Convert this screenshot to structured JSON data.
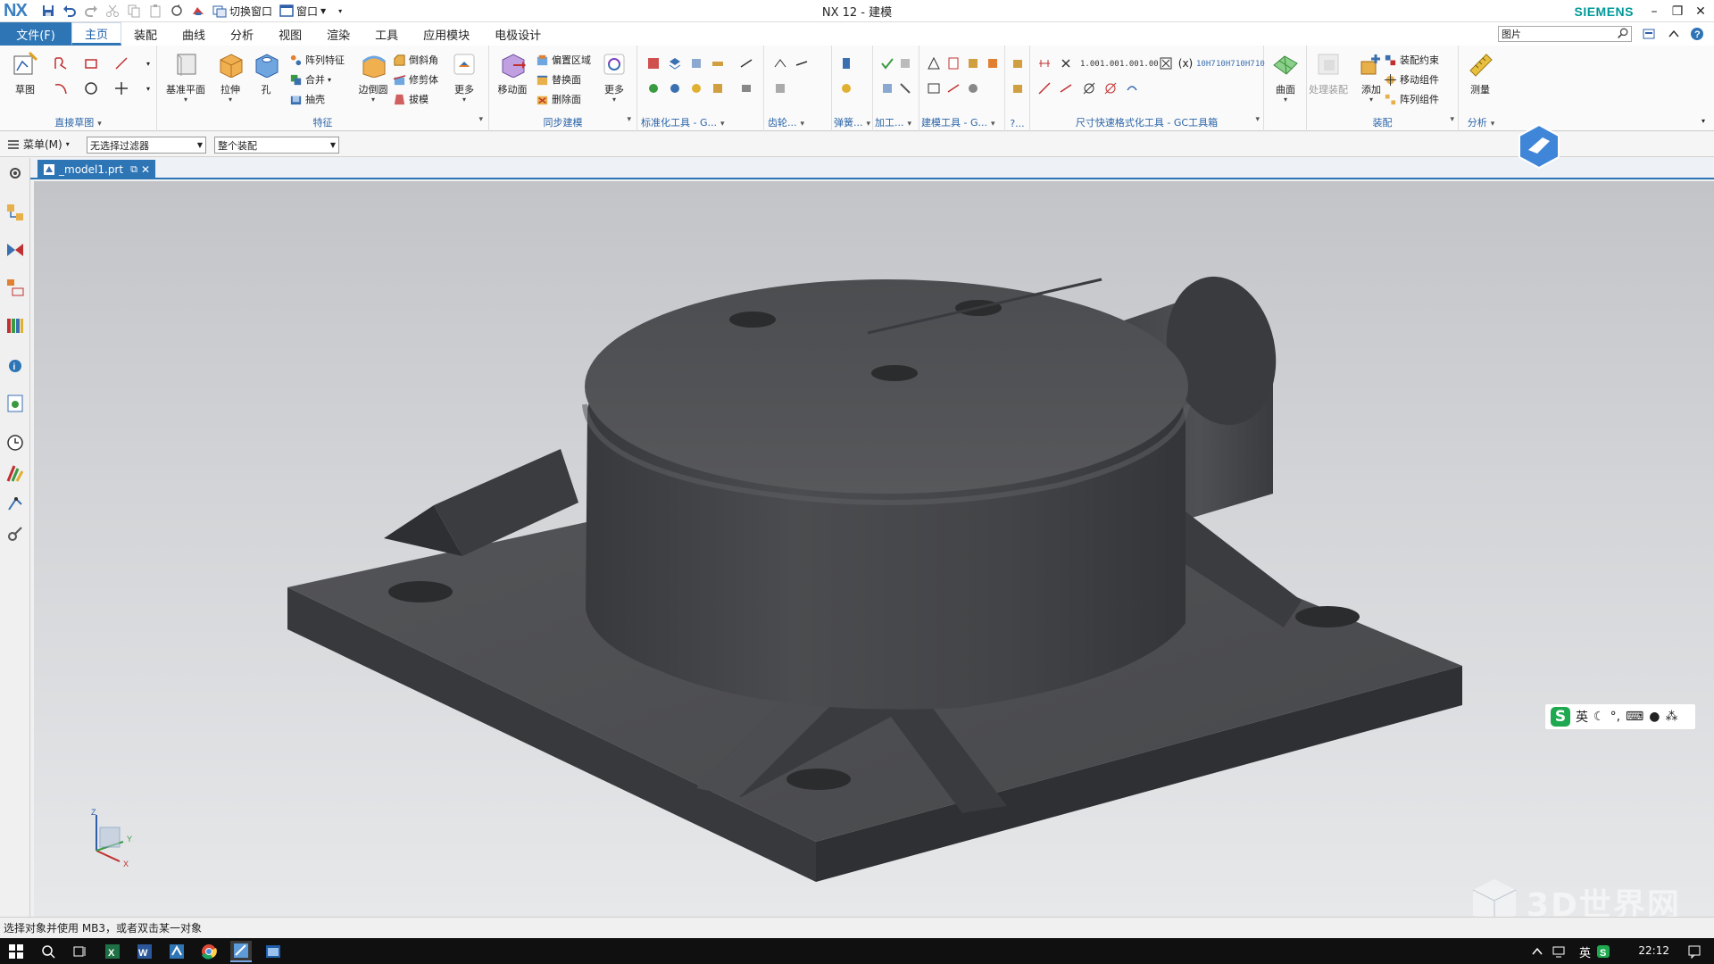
{
  "titlebar": {
    "logo": "NX",
    "switch_window": "切换窗口",
    "window_menu": "窗口",
    "title": "NX 12 - 建模",
    "brand": "SIEMENS"
  },
  "menubar": {
    "file": "文件(F)",
    "tabs": [
      "主页",
      "装配",
      "曲线",
      "分析",
      "视图",
      "渲染",
      "工具",
      "应用模块",
      "电极设计"
    ],
    "active_tab": "主页",
    "search_text": "图片"
  },
  "ribbon": {
    "direct_sketch": {
      "label": "直接草图",
      "sketch": "草图"
    },
    "feature": {
      "label": "特征",
      "datum_plane": "基准平面",
      "extrude": "拉伸",
      "hole": "孔",
      "pattern_feature": "阵列特征",
      "unite": "合并",
      "shell": "抽壳",
      "edge_blend": "边倒圆",
      "chamfer": "倒斜角",
      "trim_body": "修剪体",
      "draft": "拔模",
      "more": "更多"
    },
    "sync": {
      "label": "同步建模",
      "move_face": "移动面",
      "offset_region": "偏置区域",
      "replace_face": "替换面",
      "delete_face": "删除面",
      "more": "更多"
    },
    "std_tools": "标准化工具 - G...",
    "gear": "齿轮...",
    "spring": "弹簧...",
    "machining": "加工...",
    "modeling_tools": "建模工具 - G...",
    "more_tools": "?...",
    "dim_tools": "尺寸快速格式化工具 - GC工具箱",
    "surface": {
      "label": "曲面"
    },
    "assembly": {
      "label": "装配",
      "process_assembly": "处理装配",
      "add": "添加",
      "assembly_constraint": "装配约束",
      "move_component": "移动组件",
      "pattern_component": "阵列组件"
    },
    "analysis": {
      "label": "分析",
      "measure": "测量"
    },
    "dim_icon_texts": [
      "1.00",
      "1.00",
      "1.00",
      "1.00",
      "10H7",
      "10H7",
      "10H7",
      "10"
    ]
  },
  "selbar": {
    "menu": "菜单(M)",
    "filter": "无选择过滤器",
    "scope": "整个装配"
  },
  "doc_tab": {
    "name": "_model1.prt"
  },
  "viewport": {
    "triad": {
      "x": "X",
      "y": "Y",
      "z": "Z"
    },
    "ime_lang": "英",
    "watermark": "3D世界网"
  },
  "status": {
    "message": "选择对象并使用 MB3，或者双击某一对象"
  },
  "taskbar": {
    "ime": "英",
    "clock": "22:12"
  },
  "colors": {
    "accent": "#2e75b6",
    "model": "#4a4b4d",
    "brand": "#009999"
  }
}
